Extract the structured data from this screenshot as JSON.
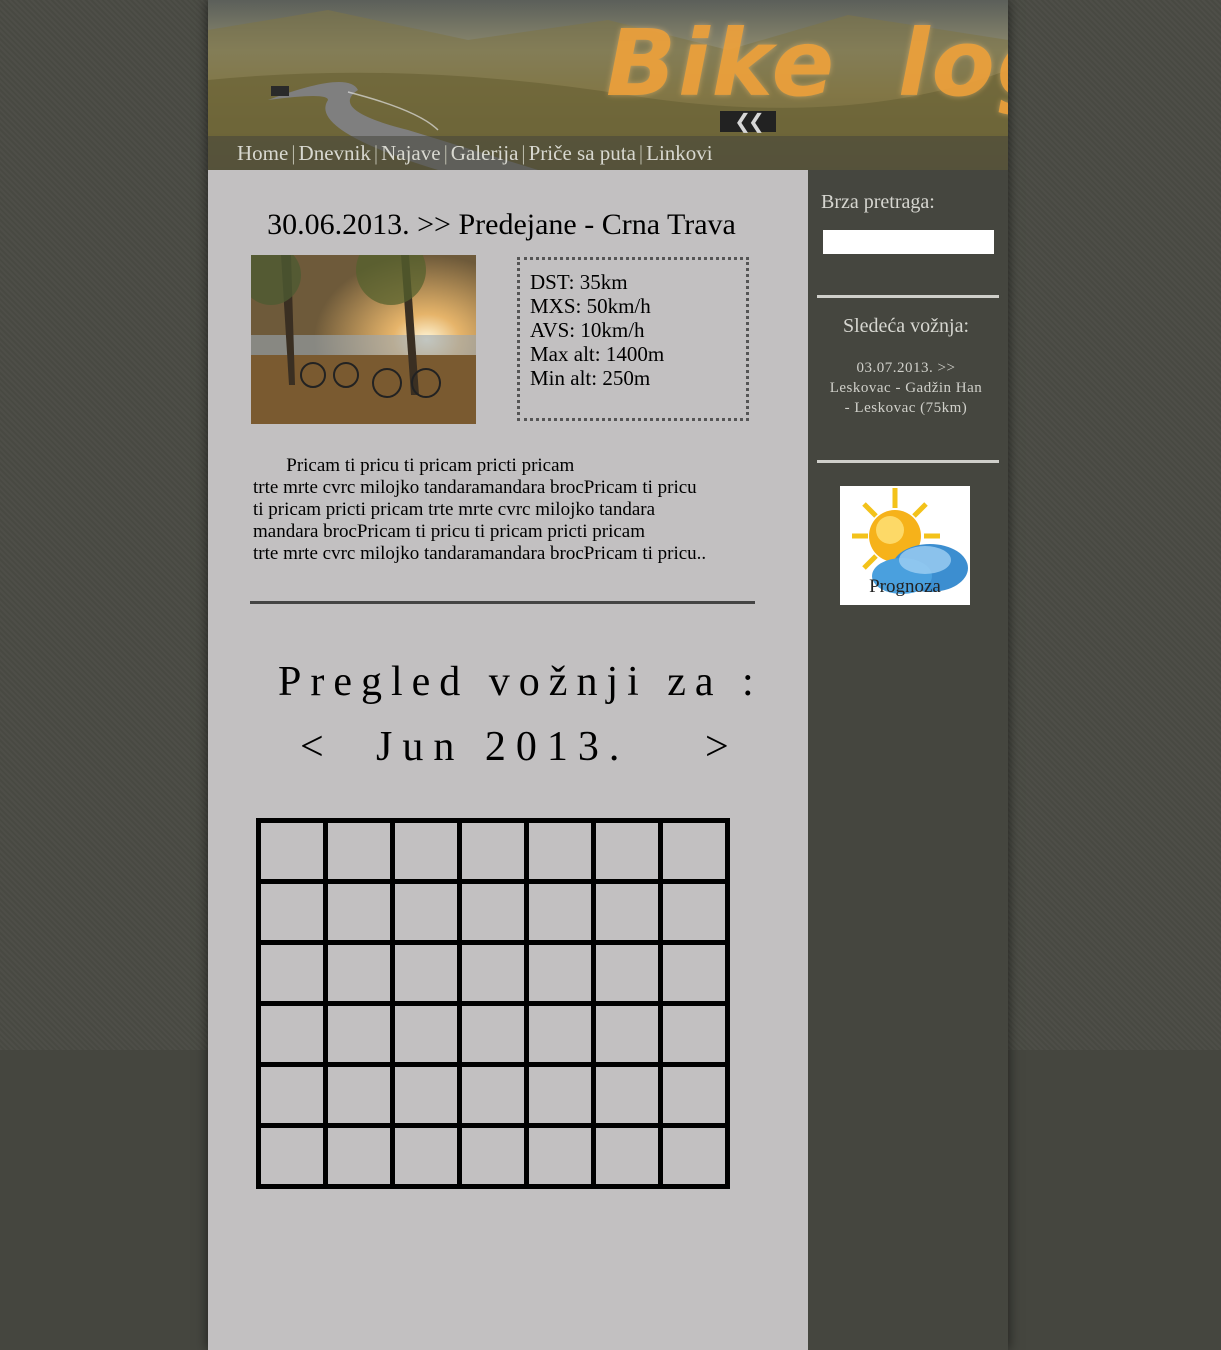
{
  "header": {
    "logo": "Bike log",
    "nav": [
      "Home",
      "Dnevnik",
      "Najave",
      "Galerija",
      "Priče sa puta",
      "Linkovi"
    ],
    "nav_separator": "|"
  },
  "post": {
    "title": "30.06.2013. >> Predejane - Crna Trava",
    "stats": [
      "DST: 35km",
      "MXS: 50km/h",
      "AVS: 10km/h",
      "Max alt: 1400m",
      "Min alt: 250m"
    ],
    "text": "       Pricam ti pricu ti pricam pricti pricam\ntrte mrte cvrc milojko tandaramandara brocPricam ti pricu\nti pricam pricti pricam trte mrte cvrc milojko tandara\nmandara brocPricam ti pricu ti pricam pricti pricam\ntrte mrte cvrc milojko tandaramandara brocPricam ti pricu.."
  },
  "review": {
    "title": "Pregled vožnji za :",
    "prev": "<",
    "month": "Jun 2013.",
    "next": ">",
    "rows": 6,
    "cols": 7
  },
  "sidebar": {
    "search_label": "Brza pretraga:",
    "search_value": "",
    "next_ride_title": "Sledeća vožnja:",
    "next_ride_text": "03.07.2013. >> Leskovac - Gadžin Han - Leskovac (75km)",
    "weather_label": "Prognoza"
  },
  "colors": {
    "background": "#45463f",
    "main_panel": "#c2c0c1",
    "logo": "#f0a23b",
    "sidebar_text": "#d6d6d0"
  }
}
